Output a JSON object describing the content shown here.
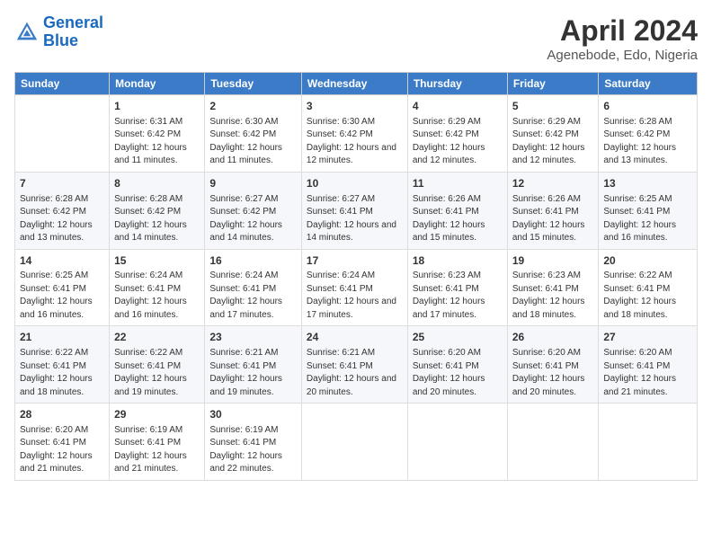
{
  "logo": {
    "line1": "General",
    "line2": "Blue"
  },
  "title": "April 2024",
  "subtitle": "Agenebode, Edo, Nigeria",
  "days_header": [
    "Sunday",
    "Monday",
    "Tuesday",
    "Wednesday",
    "Thursday",
    "Friday",
    "Saturday"
  ],
  "weeks": [
    [
      {
        "num": "",
        "sunrise": "",
        "sunset": "",
        "daylight": ""
      },
      {
        "num": "1",
        "sunrise": "Sunrise: 6:31 AM",
        "sunset": "Sunset: 6:42 PM",
        "daylight": "Daylight: 12 hours and 11 minutes."
      },
      {
        "num": "2",
        "sunrise": "Sunrise: 6:30 AM",
        "sunset": "Sunset: 6:42 PM",
        "daylight": "Daylight: 12 hours and 11 minutes."
      },
      {
        "num": "3",
        "sunrise": "Sunrise: 6:30 AM",
        "sunset": "Sunset: 6:42 PM",
        "daylight": "Daylight: 12 hours and 12 minutes."
      },
      {
        "num": "4",
        "sunrise": "Sunrise: 6:29 AM",
        "sunset": "Sunset: 6:42 PM",
        "daylight": "Daylight: 12 hours and 12 minutes."
      },
      {
        "num": "5",
        "sunrise": "Sunrise: 6:29 AM",
        "sunset": "Sunset: 6:42 PM",
        "daylight": "Daylight: 12 hours and 12 minutes."
      },
      {
        "num": "6",
        "sunrise": "Sunrise: 6:28 AM",
        "sunset": "Sunset: 6:42 PM",
        "daylight": "Daylight: 12 hours and 13 minutes."
      }
    ],
    [
      {
        "num": "7",
        "sunrise": "Sunrise: 6:28 AM",
        "sunset": "Sunset: 6:42 PM",
        "daylight": "Daylight: 12 hours and 13 minutes."
      },
      {
        "num": "8",
        "sunrise": "Sunrise: 6:28 AM",
        "sunset": "Sunset: 6:42 PM",
        "daylight": "Daylight: 12 hours and 14 minutes."
      },
      {
        "num": "9",
        "sunrise": "Sunrise: 6:27 AM",
        "sunset": "Sunset: 6:42 PM",
        "daylight": "Daylight: 12 hours and 14 minutes."
      },
      {
        "num": "10",
        "sunrise": "Sunrise: 6:27 AM",
        "sunset": "Sunset: 6:41 PM",
        "daylight": "Daylight: 12 hours and 14 minutes."
      },
      {
        "num": "11",
        "sunrise": "Sunrise: 6:26 AM",
        "sunset": "Sunset: 6:41 PM",
        "daylight": "Daylight: 12 hours and 15 minutes."
      },
      {
        "num": "12",
        "sunrise": "Sunrise: 6:26 AM",
        "sunset": "Sunset: 6:41 PM",
        "daylight": "Daylight: 12 hours and 15 minutes."
      },
      {
        "num": "13",
        "sunrise": "Sunrise: 6:25 AM",
        "sunset": "Sunset: 6:41 PM",
        "daylight": "Daylight: 12 hours and 16 minutes."
      }
    ],
    [
      {
        "num": "14",
        "sunrise": "Sunrise: 6:25 AM",
        "sunset": "Sunset: 6:41 PM",
        "daylight": "Daylight: 12 hours and 16 minutes."
      },
      {
        "num": "15",
        "sunrise": "Sunrise: 6:24 AM",
        "sunset": "Sunset: 6:41 PM",
        "daylight": "Daylight: 12 hours and 16 minutes."
      },
      {
        "num": "16",
        "sunrise": "Sunrise: 6:24 AM",
        "sunset": "Sunset: 6:41 PM",
        "daylight": "Daylight: 12 hours and 17 minutes."
      },
      {
        "num": "17",
        "sunrise": "Sunrise: 6:24 AM",
        "sunset": "Sunset: 6:41 PM",
        "daylight": "Daylight: 12 hours and 17 minutes."
      },
      {
        "num": "18",
        "sunrise": "Sunrise: 6:23 AM",
        "sunset": "Sunset: 6:41 PM",
        "daylight": "Daylight: 12 hours and 17 minutes."
      },
      {
        "num": "19",
        "sunrise": "Sunrise: 6:23 AM",
        "sunset": "Sunset: 6:41 PM",
        "daylight": "Daylight: 12 hours and 18 minutes."
      },
      {
        "num": "20",
        "sunrise": "Sunrise: 6:22 AM",
        "sunset": "Sunset: 6:41 PM",
        "daylight": "Daylight: 12 hours and 18 minutes."
      }
    ],
    [
      {
        "num": "21",
        "sunrise": "Sunrise: 6:22 AM",
        "sunset": "Sunset: 6:41 PM",
        "daylight": "Daylight: 12 hours and 18 minutes."
      },
      {
        "num": "22",
        "sunrise": "Sunrise: 6:22 AM",
        "sunset": "Sunset: 6:41 PM",
        "daylight": "Daylight: 12 hours and 19 minutes."
      },
      {
        "num": "23",
        "sunrise": "Sunrise: 6:21 AM",
        "sunset": "Sunset: 6:41 PM",
        "daylight": "Daylight: 12 hours and 19 minutes."
      },
      {
        "num": "24",
        "sunrise": "Sunrise: 6:21 AM",
        "sunset": "Sunset: 6:41 PM",
        "daylight": "Daylight: 12 hours and 20 minutes."
      },
      {
        "num": "25",
        "sunrise": "Sunrise: 6:20 AM",
        "sunset": "Sunset: 6:41 PM",
        "daylight": "Daylight: 12 hours and 20 minutes."
      },
      {
        "num": "26",
        "sunrise": "Sunrise: 6:20 AM",
        "sunset": "Sunset: 6:41 PM",
        "daylight": "Daylight: 12 hours and 20 minutes."
      },
      {
        "num": "27",
        "sunrise": "Sunrise: 6:20 AM",
        "sunset": "Sunset: 6:41 PM",
        "daylight": "Daylight: 12 hours and 21 minutes."
      }
    ],
    [
      {
        "num": "28",
        "sunrise": "Sunrise: 6:20 AM",
        "sunset": "Sunset: 6:41 PM",
        "daylight": "Daylight: 12 hours and 21 minutes."
      },
      {
        "num": "29",
        "sunrise": "Sunrise: 6:19 AM",
        "sunset": "Sunset: 6:41 PM",
        "daylight": "Daylight: 12 hours and 21 minutes."
      },
      {
        "num": "30",
        "sunrise": "Sunrise: 6:19 AM",
        "sunset": "Sunset: 6:41 PM",
        "daylight": "Daylight: 12 hours and 22 minutes."
      },
      {
        "num": "",
        "sunrise": "",
        "sunset": "",
        "daylight": ""
      },
      {
        "num": "",
        "sunrise": "",
        "sunset": "",
        "daylight": ""
      },
      {
        "num": "",
        "sunrise": "",
        "sunset": "",
        "daylight": ""
      },
      {
        "num": "",
        "sunrise": "",
        "sunset": "",
        "daylight": ""
      }
    ]
  ]
}
